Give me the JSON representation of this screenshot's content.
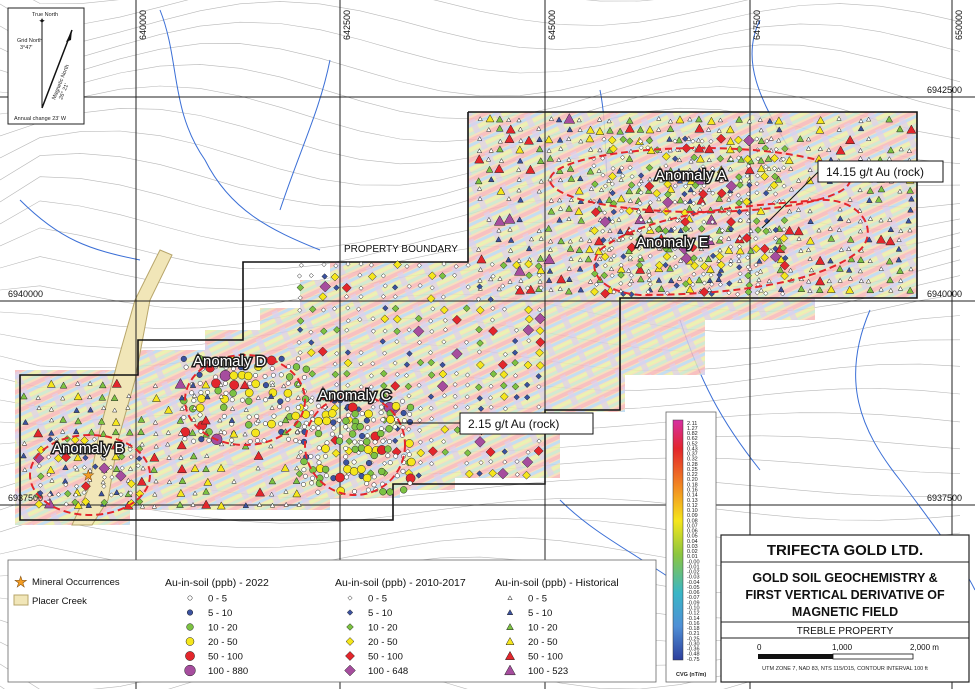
{
  "grid": {
    "eastings": [
      "640000",
      "642500",
      "645000",
      "647500",
      "650000"
    ],
    "northings": [
      "6942500",
      "6940000",
      "6937500"
    ]
  },
  "north_arrow": {
    "true_north": "True North",
    "grid_north": "Grid North",
    "grid_north_angle": "3°47'",
    "magnetic_north": "Magnetic North",
    "magnetic_angle": "26° 21'",
    "annual_change": "Annual change 23' W"
  },
  "labels": {
    "property_boundary": "PROPERTY BOUNDARY",
    "anomalies": [
      "Anomaly A",
      "Anomaly E",
      "Anomaly D",
      "Anomaly C",
      "Anomaly B"
    ],
    "callout_1": "14.15 g/t Au (rock)",
    "callout_2": "2.15 g/t Au (rock)"
  },
  "legend": {
    "mineral_occurrences": "Mineral Occurrences",
    "placer_creek": "Placer Creek",
    "group_2022": {
      "title": "Au-in-soil (ppb) - 2022",
      "items": [
        "0 - 5",
        "5 - 10",
        "10 - 20",
        "20 - 50",
        "50 - 100",
        "100 - 880"
      ]
    },
    "group_2010": {
      "title": "Au-in-soil (ppb) - 2010-2017",
      "items": [
        "0 - 5",
        "5 - 10",
        "10 - 20",
        "20 - 50",
        "50 - 100",
        "100 - 648"
      ]
    },
    "group_hist": {
      "title": "Au-in-soil (ppb) - Historical",
      "items": [
        "0 - 5",
        "5 - 10",
        "10 - 20",
        "20 - 50",
        "50 - 100",
        "100 - 523"
      ]
    },
    "class_colors": [
      "#ffffff",
      "#3b52a0",
      "#7cc242",
      "#f5e61c",
      "#e3262c",
      "#a64d9e"
    ]
  },
  "colorbar": {
    "ticks": [
      "2.11",
      "1.27",
      "0.82",
      "0.62",
      "0.52",
      "0.43",
      "0.37",
      "0.32",
      "0.28",
      "0.25",
      "0.22",
      "0.20",
      "0.18",
      "0.16",
      "0.14",
      "0.13",
      "0.12",
      "0.10",
      "0.09",
      "0.08",
      "0.07",
      "0.06",
      "0.05",
      "0.04",
      "0.03",
      "0.02",
      "0.01",
      "-0.00",
      "-0.01",
      "-0.02",
      "-0.03",
      "-0.04",
      "-0.05",
      "-0.06",
      "-0.07",
      "-0.09",
      "-0.10",
      "-0.12",
      "-0.14",
      "-0.16",
      "-0.18",
      "-0.21",
      "-0.25",
      "-0.30",
      "-0.36",
      "-0.48",
      "-0.75"
    ],
    "unit": "CVG (nT/m)"
  },
  "title_block": {
    "company": "TRIFECTA GOLD LTD.",
    "subtitle": "GOLD SOIL GEOCHEMISTRY & FIRST VERTICAL DERIVATIVE OF MAGNETIC FIELD",
    "project": "TREBLE PROPERTY",
    "scale_labels": [
      "0",
      "1,000",
      "2,000 m"
    ],
    "projection_note": "UTM ZONE 7, NAD 83, NTS 115/O15, CONTOUR INTERVAL 100 ft"
  }
}
